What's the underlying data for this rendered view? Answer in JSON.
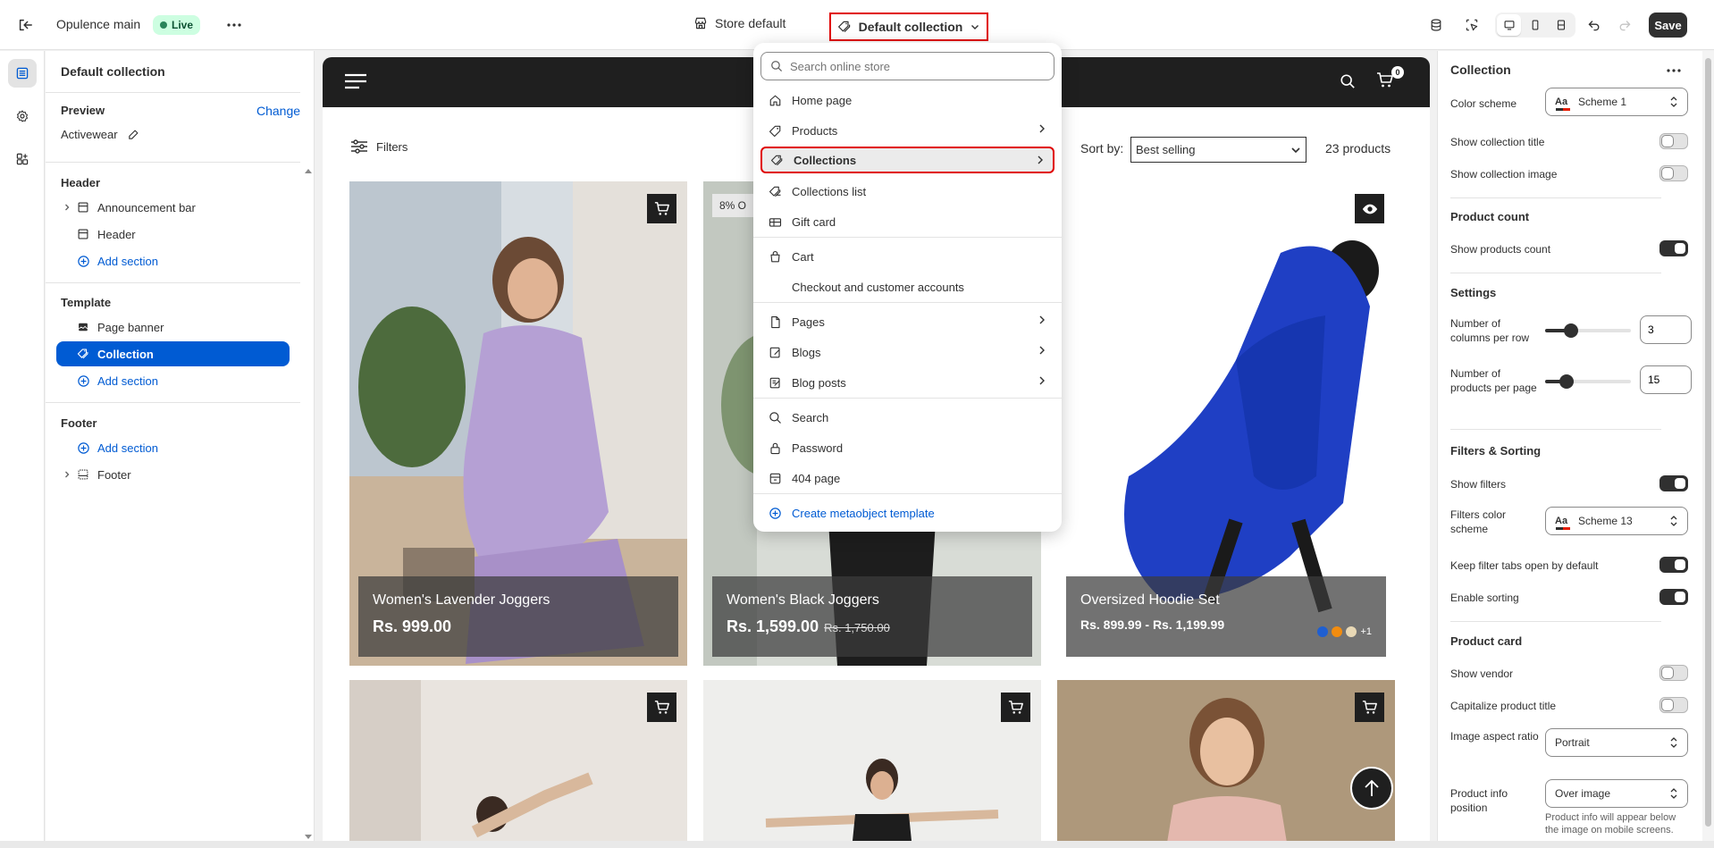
{
  "topbar": {
    "theme_name": "Opulence main",
    "live_badge": "Live",
    "store_selector": "Store default",
    "template_selector": "Default collection",
    "save_label": "Save"
  },
  "sections_panel": {
    "title": "Default collection",
    "preview_label": "Preview",
    "change_link": "Change",
    "preview_value": "Activewear",
    "header_group": {
      "title": "Header",
      "items": [
        "Announcement bar",
        "Header"
      ],
      "add_label": "Add section"
    },
    "template_group": {
      "title": "Template",
      "items": [
        "Page banner",
        "Collection"
      ],
      "add_label": "Add section"
    },
    "footer_group": {
      "title": "Footer",
      "add_label": "Add section",
      "items": [
        "Footer"
      ]
    }
  },
  "dropdown": {
    "search_placeholder": "Search online store",
    "items": [
      {
        "label": "Home page",
        "icon": "home-icon",
        "submenu": false
      },
      {
        "label": "Products",
        "icon": "tag-icon",
        "submenu": true
      },
      {
        "label": "Collections",
        "icon": "collection-icon",
        "submenu": true
      },
      {
        "label": "Collections list",
        "icon": "collection-list-icon",
        "submenu": false
      },
      {
        "label": "Gift card",
        "icon": "gift-card-icon",
        "submenu": false
      },
      {
        "label": "Cart",
        "icon": "cart-bag-icon",
        "submenu": false
      },
      {
        "label": "Checkout and customer accounts",
        "icon": "",
        "submenu": false
      },
      {
        "label": "Pages",
        "icon": "page-icon",
        "submenu": true
      },
      {
        "label": "Blogs",
        "icon": "blog-icon",
        "submenu": true
      },
      {
        "label": "Blog posts",
        "icon": "blog-post-icon",
        "submenu": true
      },
      {
        "label": "Search",
        "icon": "search-icon",
        "submenu": false
      },
      {
        "label": "Password",
        "icon": "lock-icon",
        "submenu": false
      },
      {
        "label": "404 page",
        "icon": "404-icon",
        "submenu": false
      }
    ],
    "create_label": "Create metaobject template"
  },
  "storefront": {
    "cart_count": "0",
    "filters_label": "Filters",
    "sort_label": "Sort by:",
    "sort_value": "Best selling",
    "product_count": "23 products",
    "products": [
      {
        "name": "Women's Lavender Joggers",
        "price": "Rs. 999.00",
        "compare": ""
      },
      {
        "name": "Women's Black Joggers",
        "price": "Rs. 1,599.00",
        "compare": "Rs. 1,750.00",
        "badge": "8% O"
      },
      {
        "name": "Oversized Hoodie Set",
        "price": "Rs. 899.99 - Rs. 1,199.99",
        "compare": "",
        "more_colors": "+1"
      }
    ],
    "swatch_colors": [
      "#1f5fd1",
      "#f28c0f",
      "#e8d8b5"
    ]
  },
  "settings_panel": {
    "title": "Collection",
    "color_scheme_label": "Color scheme",
    "color_scheme_value": "Scheme 1",
    "show_title_label": "Show collection title",
    "show_image_label": "Show collection image",
    "product_count_head": "Product count",
    "show_products_count_label": "Show products count",
    "settings_head": "Settings",
    "columns_label": "Number of columns per row",
    "columns_value": "3",
    "columns_fraction": 0.3,
    "per_page_label": "Number of products per page",
    "per_page_value": "15",
    "per_page_fraction": 0.25,
    "filters_head": "Filters & Sorting",
    "show_filters_label": "Show filters",
    "filters_scheme_label": "Filters color scheme",
    "filters_scheme_value": "Scheme 13",
    "keep_tabs_label": "Keep filter tabs open by default",
    "enable_sorting_label": "Enable sorting",
    "product_card_head": "Product card",
    "show_vendor_label": "Show vendor",
    "capitalize_label": "Capitalize product title",
    "aspect_label": "Image aspect ratio",
    "aspect_value": "Portrait",
    "info_position_label": "Product info position",
    "info_position_value": "Over image",
    "info_position_help": "Product info will appear below the image on mobile screens."
  },
  "colors": {
    "accent_blue": "#005bd3",
    "highlight_red": "#e00000",
    "dark": "#303030"
  }
}
